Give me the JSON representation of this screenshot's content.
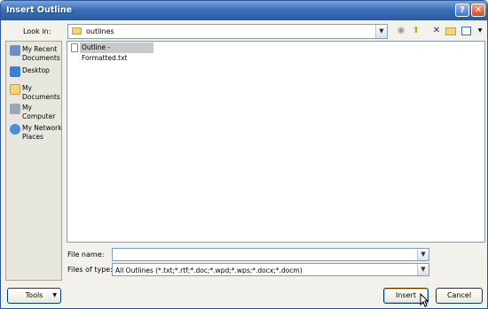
{
  "window": {
    "title": "Insert Outline"
  },
  "titlebar": {
    "help_label": "?",
    "close_label": "✕"
  },
  "lookin": {
    "label": "Look in:",
    "value": "outlines"
  },
  "places": [
    {
      "label": "My Recent Documents",
      "icon": "recent-documents-icon",
      "color": "#6d8fc6"
    },
    {
      "label": "Desktop",
      "icon": "desktop-icon",
      "color": "#3b7fd0"
    },
    {
      "label": "My Documents",
      "icon": "my-documents-icon",
      "color": "#f4d37b"
    },
    {
      "label": "My Computer",
      "icon": "my-computer-icon",
      "color": "#9aa6b8"
    },
    {
      "label": "My Network Places",
      "icon": "network-places-icon",
      "color": "#4a8fd6"
    }
  ],
  "files": [
    {
      "name": "Outline - Formatted.txt"
    }
  ],
  "filename": {
    "label": "File name:",
    "value": ""
  },
  "filetype": {
    "label": "Files of type:",
    "value": "All Outlines (*.txt;*.rtf;*.doc;*.wpd;*.wps;*.docx;*.docm)"
  },
  "buttons": {
    "tools": "Tools",
    "insert": "Insert",
    "cancel": "Cancel"
  }
}
